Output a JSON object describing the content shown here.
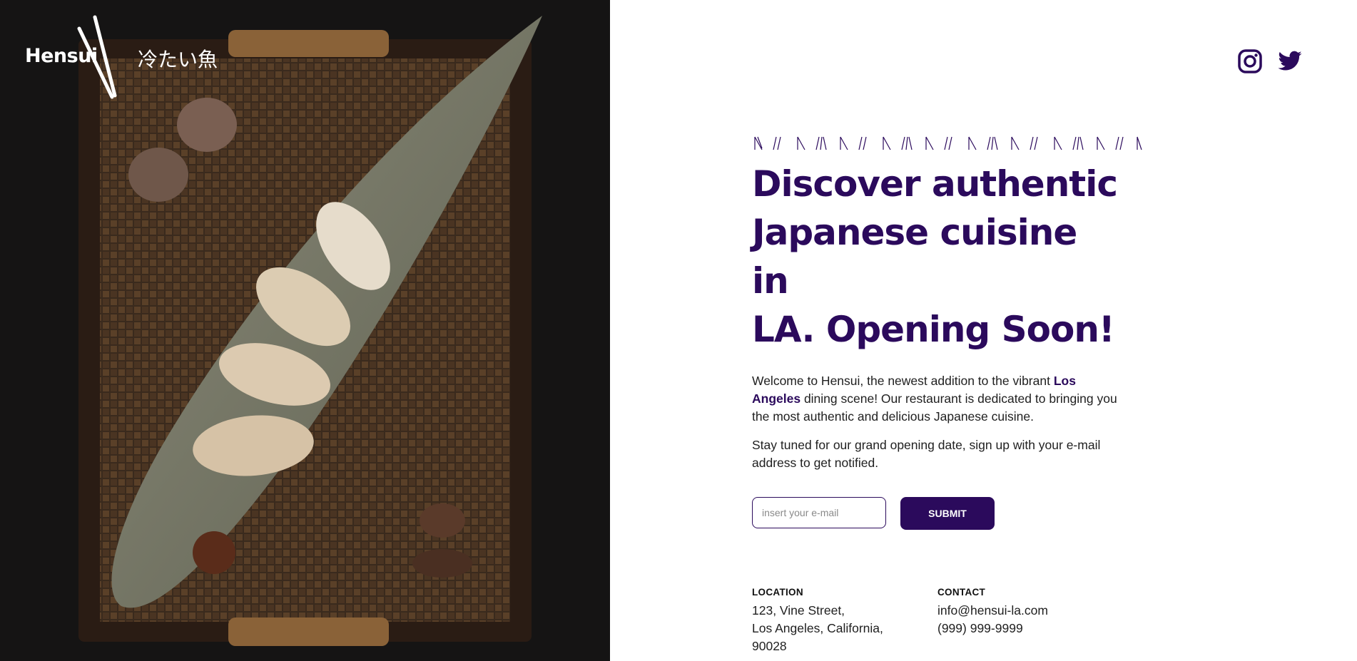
{
  "brand": {
    "name": "Hensui",
    "tagline_jp": "冷たい魚"
  },
  "social": {
    "icons": [
      "instagram-icon",
      "twitter-icon"
    ]
  },
  "hero": {
    "headline_line1": "Discover authentic",
    "headline_line2": "Japanese cuisine in",
    "headline_line3": "LA. Opening Soon!",
    "para1_pre": "Welcome to Hensui, the newest addition to the vibrant ",
    "para1_bold": "Los Angeles",
    "para1_post": " dining scene! Our restaurant is dedicated to bringing you the most authentic and delicious Japanese cuisine.",
    "para2": "Stay tuned for our grand opening date, sign up with your e-mail address to get notified."
  },
  "signup": {
    "email_placeholder": "insert your e-mail",
    "email_value": "",
    "submit_label": "SUBMIT"
  },
  "location": {
    "heading": "LOCATION",
    "line1": "123, Vine Street,",
    "line2": "Los Angeles, California,",
    "line3": "90028"
  },
  "contact": {
    "heading": "CONTACT",
    "email": "info@hensui-la.com",
    "phone": "(999) 999-9999"
  },
  "colors": {
    "accent": "#2b0a5c",
    "photo_bg": "#141313"
  }
}
